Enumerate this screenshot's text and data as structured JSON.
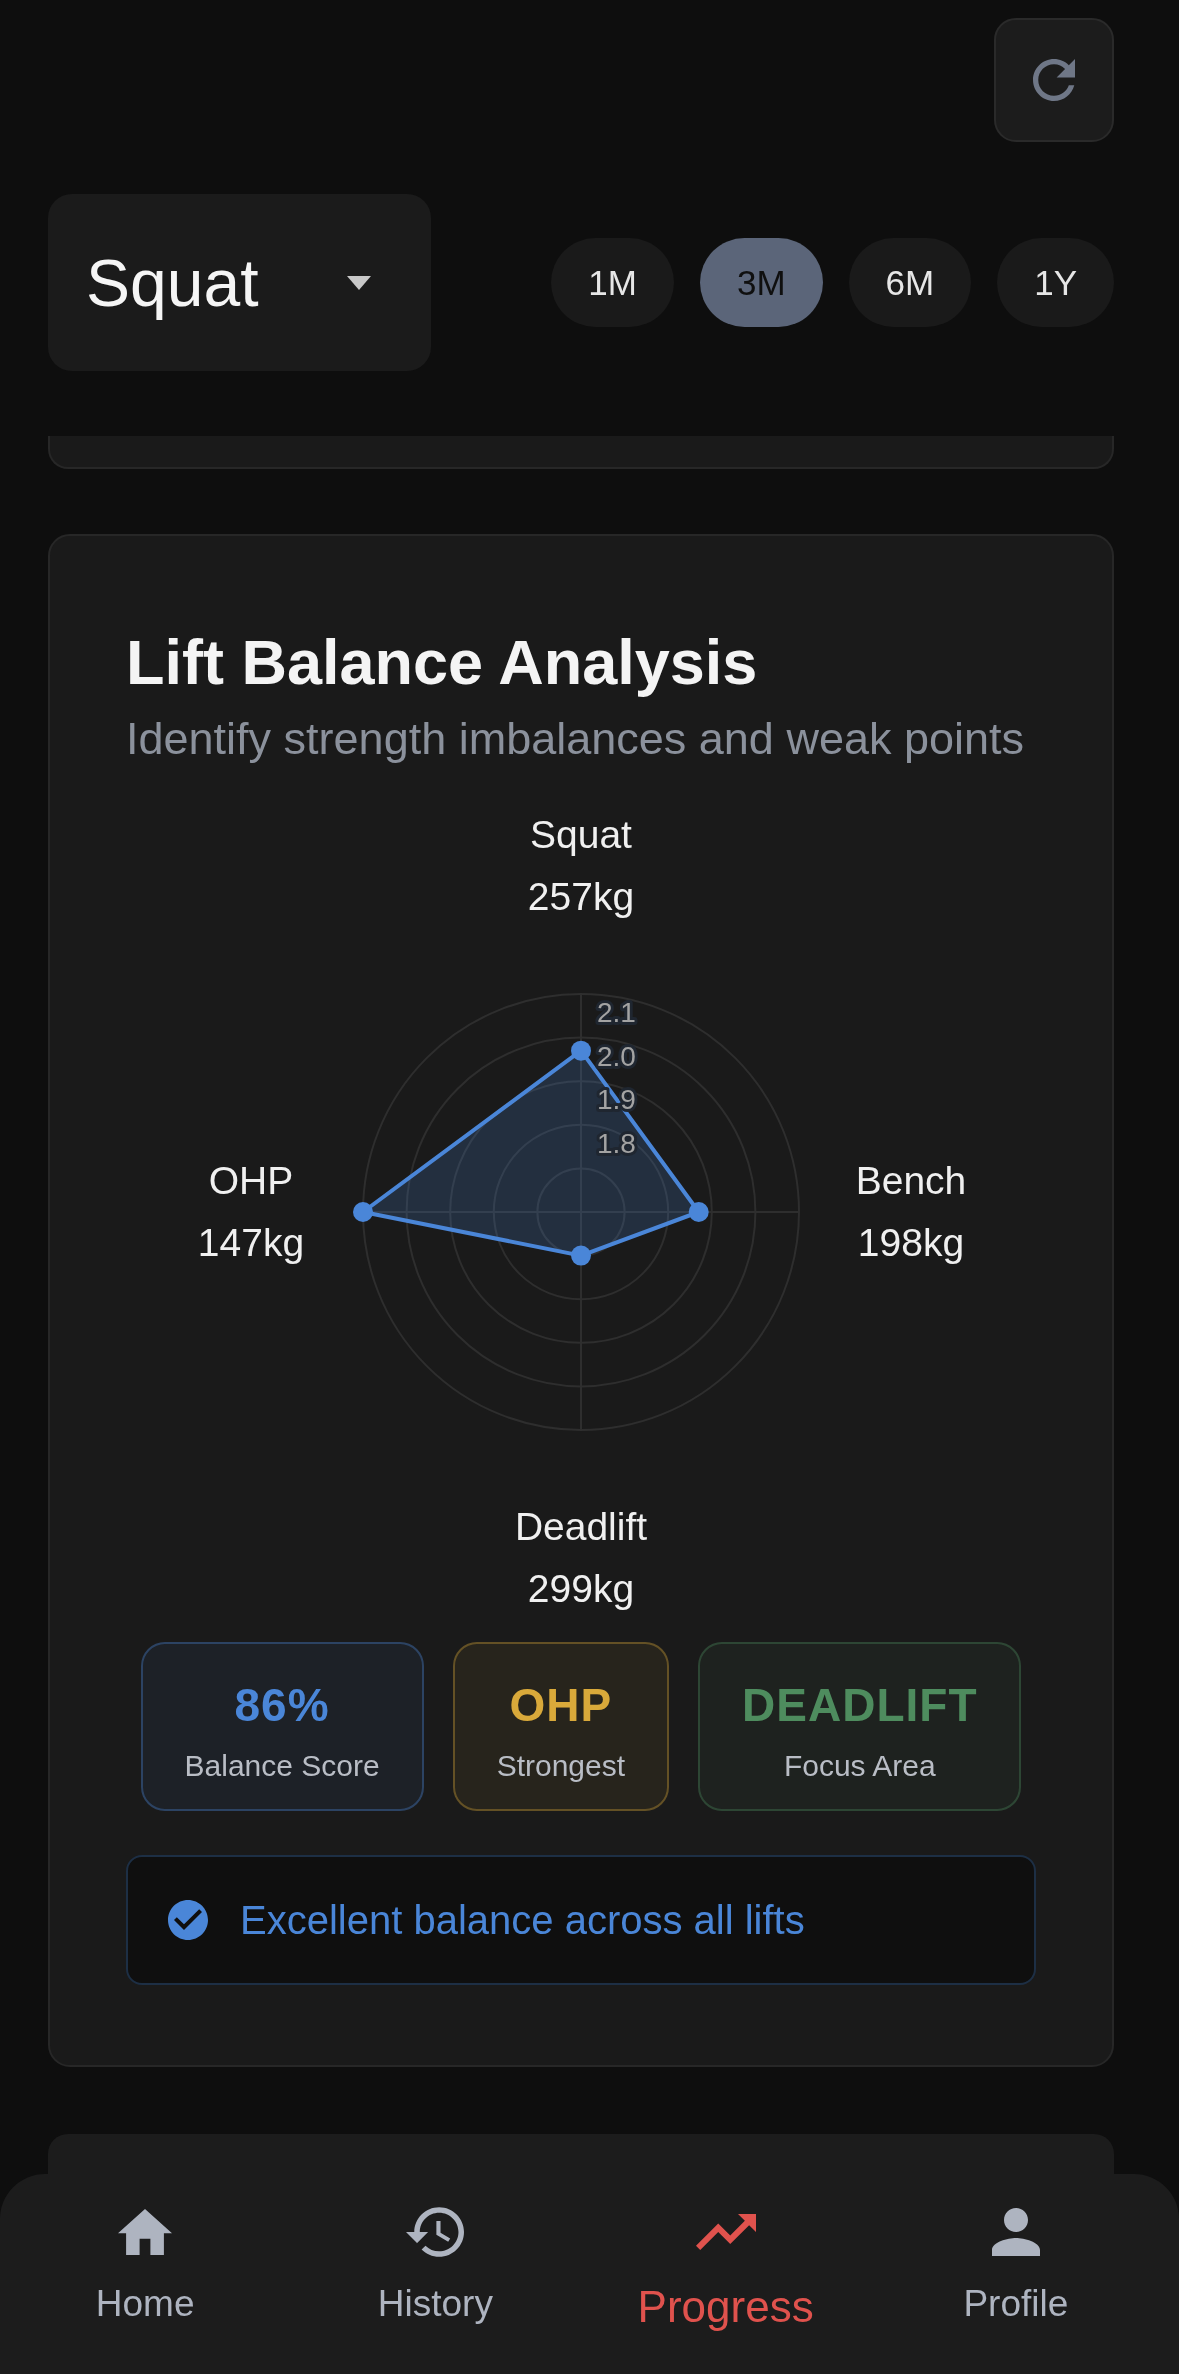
{
  "header": {
    "exercise": {
      "value": "Squat"
    },
    "time_ranges": [
      {
        "label": "1M",
        "selected": false
      },
      {
        "label": "3M",
        "selected": true
      },
      {
        "label": "6M",
        "selected": false
      },
      {
        "label": "1Y",
        "selected": false
      }
    ]
  },
  "balance_card": {
    "title": "Lift Balance Analysis",
    "subtitle": "Identify strength imbalances and weak points",
    "chart_data": {
      "type": "radar",
      "categories": [
        "Squat",
        "Bench",
        "Deadlift",
        "OHP"
      ],
      "values": [
        1.97,
        1.87,
        1.7,
        2.1
      ],
      "ylim": [
        1.6,
        2.1
      ],
      "yticks": [
        1.8,
        1.9,
        {
          "value": 2.0,
          "label": "2.0"
        },
        2.1
      ]
    },
    "lift_weights": [
      "257kg",
      "198kg",
      "299kg",
      "147kg"
    ],
    "stats": [
      {
        "value": "86%",
        "label": "Balance Score",
        "color": "#4a86d8"
      },
      {
        "value": "OHP",
        "label": "Strongest",
        "color": "#d9a93a"
      },
      {
        "value": "DEADLIFT",
        "label": "Focus Area",
        "color": "#4e8c5e"
      }
    ],
    "status": {
      "text": "Excellent balance across all lifts"
    }
  },
  "bottom_nav": [
    {
      "label": "Home",
      "selected": false
    },
    {
      "label": "History",
      "selected": false
    },
    {
      "label": "Progress",
      "selected": true
    },
    {
      "label": "Profile",
      "selected": false
    }
  ]
}
